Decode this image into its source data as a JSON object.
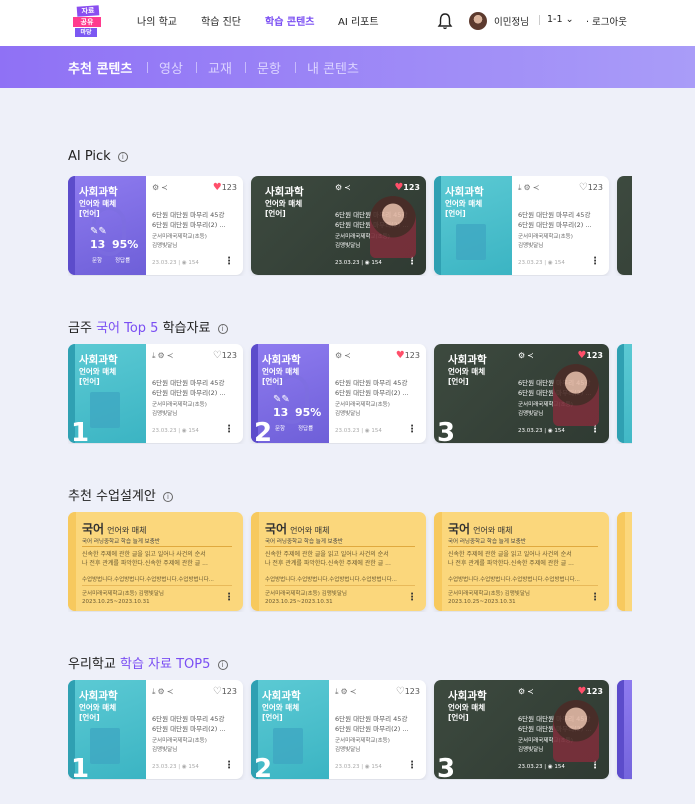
{
  "header": {
    "logo": [
      "자료",
      "공유",
      "마당"
    ],
    "nav": [
      "나의 학교",
      "학습 진단",
      "학습 콘텐츠",
      "AI 리포트"
    ],
    "active_nav": "학습 콘텐츠",
    "user_name": "이민정님",
    "class": "1-1",
    "logout": "로그아웃"
  },
  "subnav": {
    "items": [
      "추천 콘텐츠",
      "영상",
      "교재",
      "문항",
      "내 콘텐츠"
    ],
    "active": "추천 콘텐츠"
  },
  "sections": {
    "ai_pick": {
      "title": "AI Pick"
    },
    "weekly": {
      "pre": "금주 ",
      "highlight": "국어 Top 5",
      "post": " 학습자료"
    },
    "lesson": {
      "title": "추천 수업설계안"
    },
    "school": {
      "pre": "우리학교 ",
      "highlight": "학습 자료 TOP5"
    }
  },
  "card_common": {
    "title": "사회과학",
    "sub1": "언어와 매체",
    "sub2": "[언어]",
    "desc1": "6단원 대단원 마무리 45강",
    "desc2": "6단원 대단원 마무리(2) ...",
    "school": "군서미래국제학교(초등)",
    "teacher": "김맹빛달님",
    "date": "23.03.23",
    "views": "154",
    "likes": "123",
    "stat_count": "13",
    "stat_rate": "95%",
    "stat_count_label": "문항",
    "stat_rate_label": "정답률"
  },
  "ranks": [
    "1",
    "2",
    "3"
  ],
  "plan": {
    "subject": "국어",
    "unit": "언어와 매체",
    "goal": "국어 러닝중학교 학습 늘게 보충반",
    "body1": "신속한 주제에 관한 글을 읽고 일어나 사건의 순서",
    "body2": "나 전후 관계를 파악한다.신속한 주제에 관한 글 ...",
    "aim": "수업방법니다.수업방법니다.수업방법니다.수업방법니다...",
    "school": "군서미래국제학교(초등) 김맹빛달님",
    "period": "2023.10.25~2023.10.31"
  }
}
